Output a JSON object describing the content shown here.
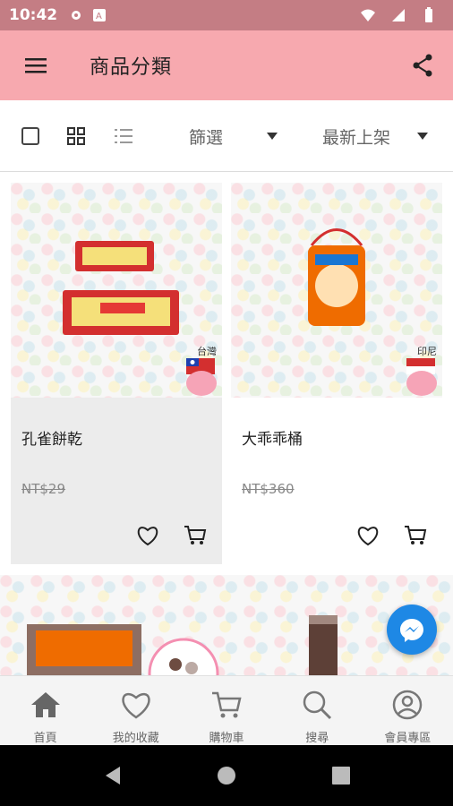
{
  "status_bar": {
    "time": "10:42",
    "icons": [
      "gear-icon",
      "a-icon",
      "wifi-icon",
      "battery-icon"
    ]
  },
  "app_bar": {
    "title": "商品分類",
    "menu_icon": "hamburger-icon",
    "share_icon": "share-icon"
  },
  "toolbar": {
    "filter_label": "篩選",
    "sort_label": "最新上架"
  },
  "products": [
    {
      "name": "孔雀餅乾",
      "price": "NT$29",
      "country": "台灣"
    },
    {
      "name": "大乖乖桶",
      "price": "NT$360",
      "country": "印尼"
    }
  ],
  "bottom_nav": {
    "items": [
      {
        "label": "首頁",
        "icon": "home-icon"
      },
      {
        "label": "我的收藏",
        "icon": "heart-icon"
      },
      {
        "label": "購物車",
        "icon": "cart-icon"
      },
      {
        "label": "搜尋",
        "icon": "search-icon"
      },
      {
        "label": "會員專區",
        "icon": "person-icon"
      }
    ]
  },
  "colors": {
    "status_bar": "#c47d84",
    "app_bar": "#f7a9af",
    "messenger": "#1e88e5"
  }
}
